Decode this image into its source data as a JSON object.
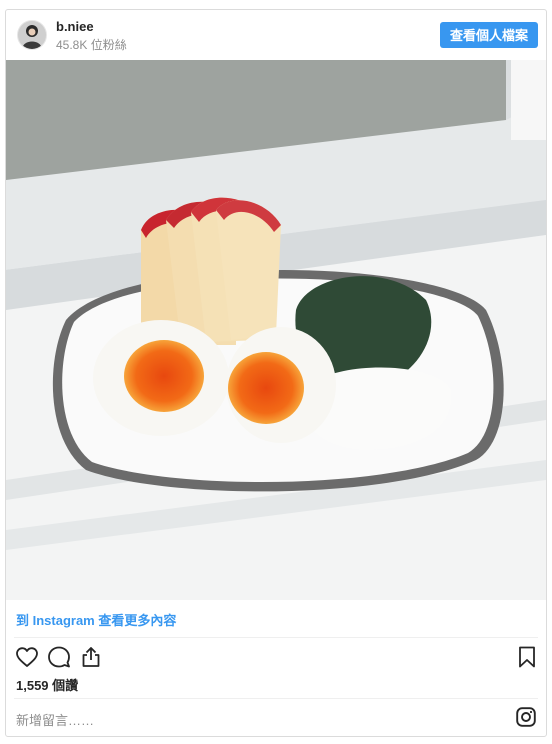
{
  "header": {
    "username": "b.niee",
    "followers": "45.8K 位粉絲",
    "profile_button": "查看個人檔案"
  },
  "post": {
    "view_more_link": "到 Instagram 查看更多內容",
    "likes": "1,559 個讚",
    "comment_placeholder": "新增留言……"
  },
  "icons": {
    "like": "heart-icon",
    "comment": "comment-icon",
    "share": "share-icon",
    "save": "bookmark-icon",
    "logo": "instagram-icon"
  },
  "colors": {
    "accent": "#3897f0",
    "border": "#dbdbdb",
    "muted": "#8e8e8e"
  }
}
